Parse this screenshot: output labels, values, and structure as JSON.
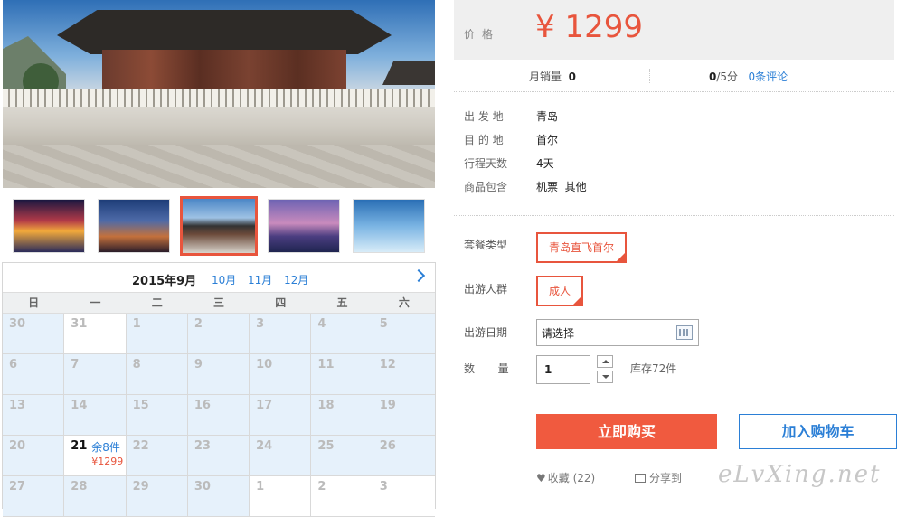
{
  "price": {
    "label": "价格",
    "value": "¥ 1299"
  },
  "sales": {
    "monthly_label": "月销量",
    "monthly_value": "0",
    "rating_value": "0",
    "rating_suffix": "/5分",
    "reviews_link": "0条评论"
  },
  "info": [
    {
      "key": "出 发 地",
      "value": "青岛"
    },
    {
      "key": "目 的 地",
      "value": "首尔"
    },
    {
      "key": "行程天数",
      "value": "4天"
    },
    {
      "key": "商品包含",
      "value": "机票  其他"
    }
  ],
  "options": {
    "package_label": "套餐类型",
    "package_value": "青岛直飞首尔",
    "group_label": "出游人群",
    "group_value": "成人",
    "date_label": "出游日期",
    "date_placeholder": "请选择",
    "qty_label": "数  量",
    "qty_value": "1",
    "stock": "库存72件"
  },
  "actions": {
    "buy": "立即购买",
    "cart": "加入购物车",
    "favorite": "收藏 (22)",
    "share": "分享到"
  },
  "watermark": "eLvXing.net",
  "calendar": {
    "title": "2015年9月",
    "months": [
      "10月",
      "11月",
      "12月"
    ],
    "weekdays": [
      "日",
      "一",
      "二",
      "三",
      "四",
      "五",
      "六"
    ],
    "days": [
      "30",
      "31",
      "1",
      "2",
      "3",
      "4",
      "5",
      "6",
      "7",
      "8",
      "9",
      "10",
      "11",
      "12",
      "13",
      "14",
      "15",
      "16",
      "17",
      "18",
      "19",
      "20",
      "21",
      "22",
      "23",
      "24",
      "25",
      "26",
      "27",
      "28",
      "29",
      "30",
      "1",
      "2",
      "3"
    ],
    "selected": {
      "day": "21",
      "stock": "余8件",
      "price": "¥1299"
    }
  }
}
